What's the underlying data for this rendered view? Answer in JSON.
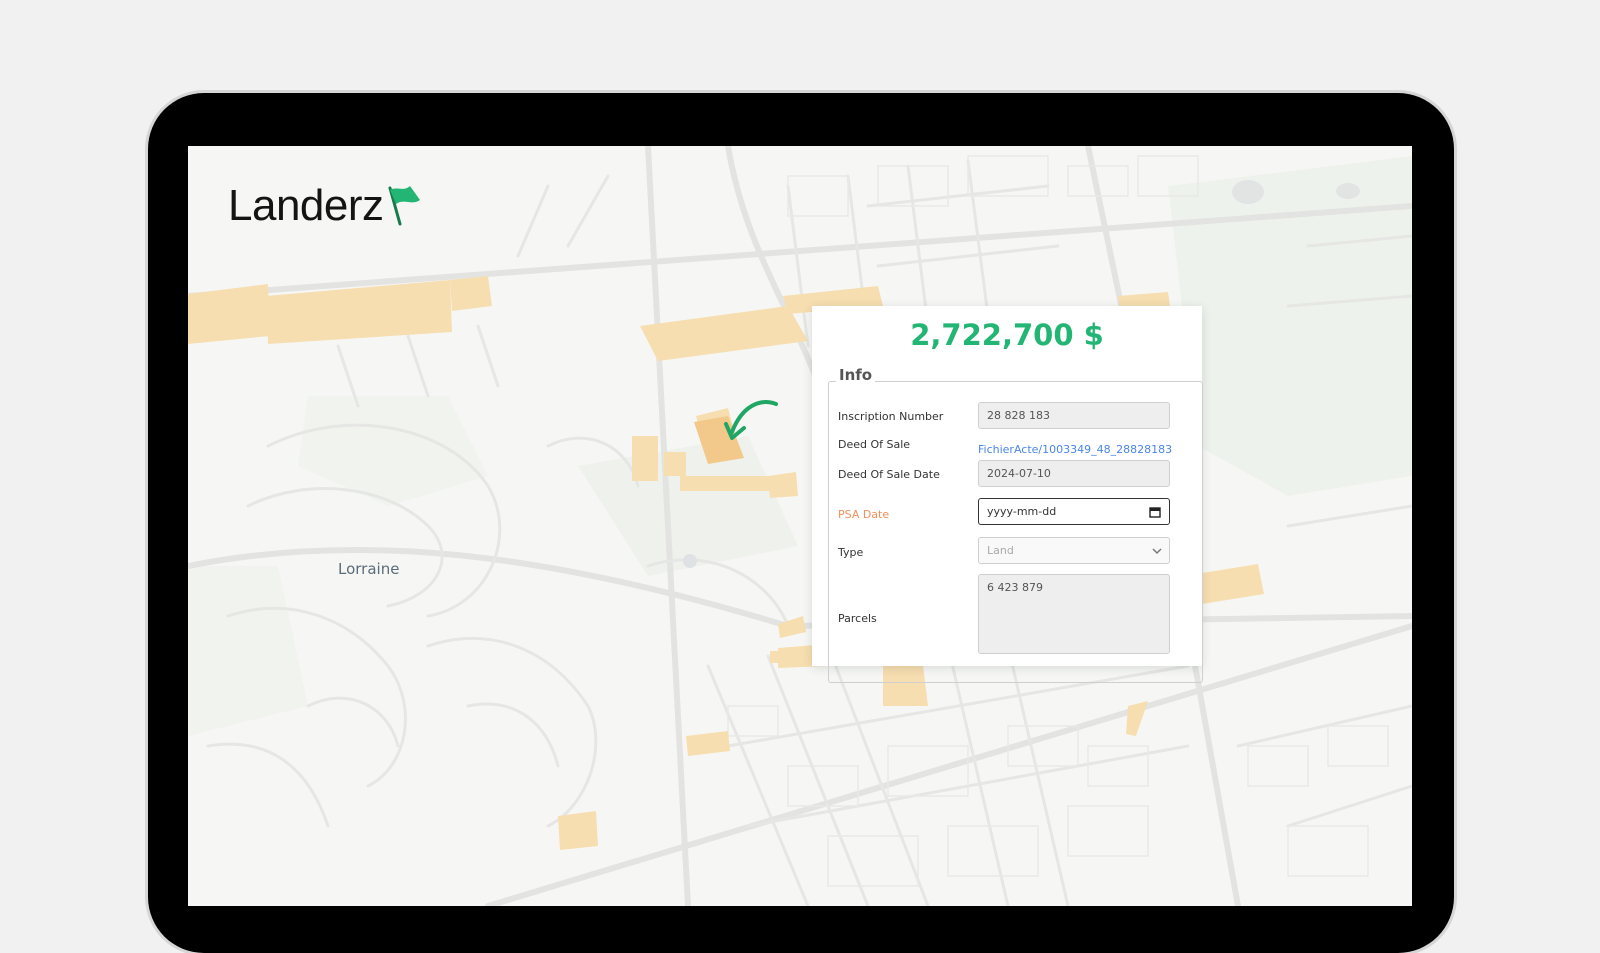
{
  "brand": {
    "name": "Landerz",
    "accent": "#22b573"
  },
  "map": {
    "place_label": "Lorraine"
  },
  "property": {
    "price": "2,722,700 $",
    "section_title": "Info",
    "fields": {
      "inscription_number": {
        "label": "Inscription Number",
        "value": "28 828 183"
      },
      "deed_of_sale": {
        "label": "Deed Of Sale",
        "link": "FichierActe/1003349_48_28828183.pdf"
      },
      "deed_of_sale_date": {
        "label": "Deed Of Sale Date",
        "value": "2024-07-10"
      },
      "psa_date": {
        "label": "PSA Date",
        "placeholder": "yyyy-mm-dd"
      },
      "type": {
        "label": "Type",
        "value": "Land",
        "options": [
          "Land"
        ]
      },
      "parcels": {
        "label": "Parcels",
        "value": "6 423 879"
      }
    }
  },
  "icons": {
    "logo_flag": "flag-icon",
    "pointer": "curved-arrow-icon",
    "date_picker": "calendar-icon",
    "select": "chevron-down-icon"
  }
}
